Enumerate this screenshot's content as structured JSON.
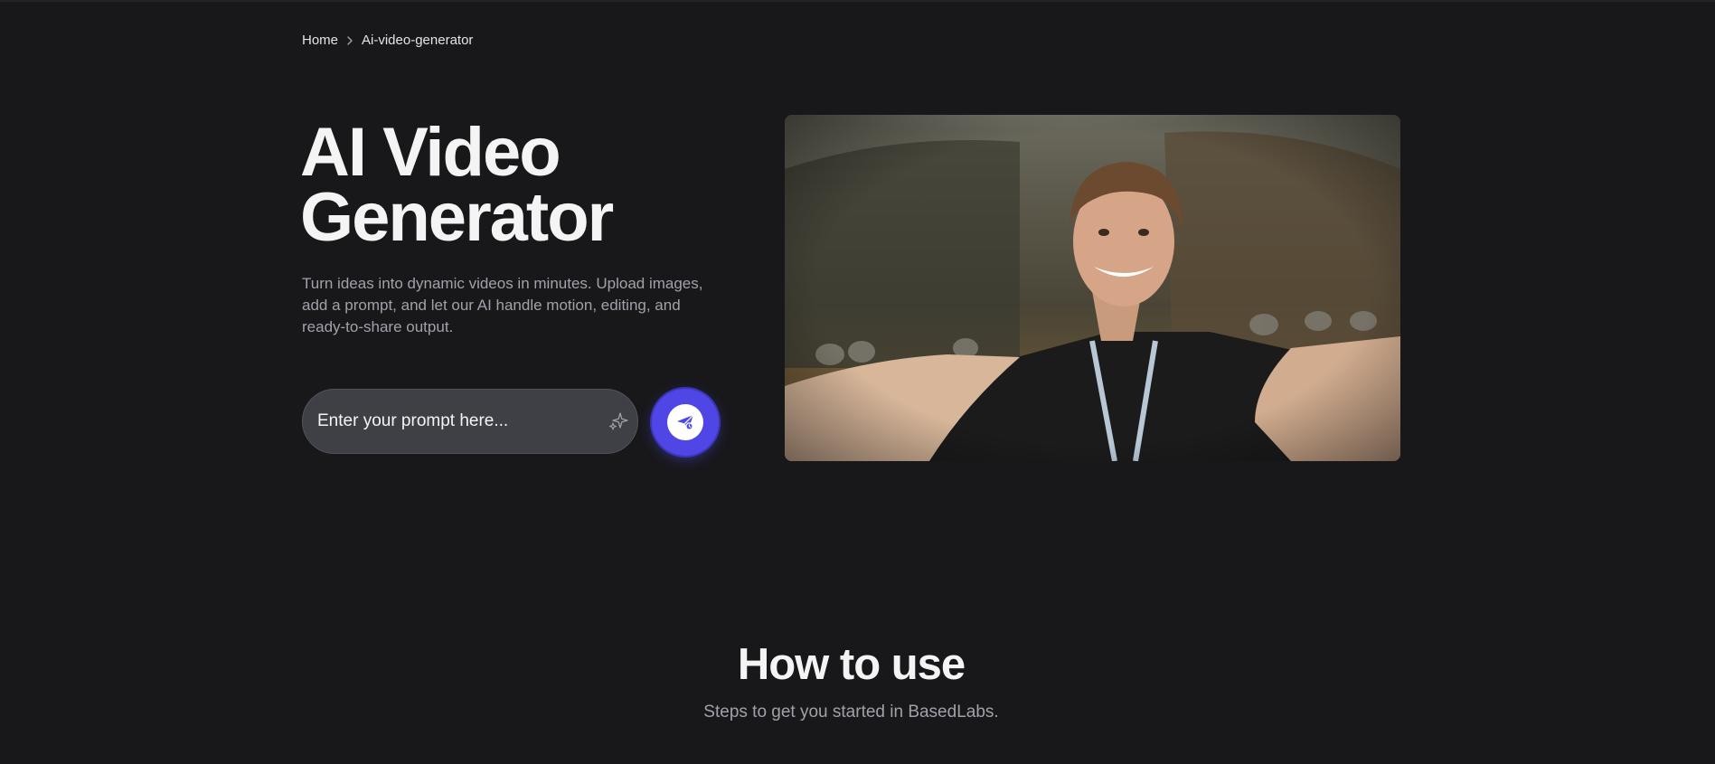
{
  "breadcrumb": {
    "home": "Home",
    "separator_icon": "chevron-right-icon",
    "current": "Ai-video-generator"
  },
  "hero": {
    "title": "AI Video Generator",
    "description": "Turn ideas into dynamic videos in minutes. Upload images, add a prompt, and let our AI handle motion, editing, and ready-to-share output.",
    "prompt_placeholder": "Enter your prompt here...",
    "prompt_value": "",
    "sparkle_icon": "sparkle-icon",
    "send_icon": "send-icon",
    "accent_color": "#4f46e5"
  },
  "how_to_use": {
    "title": "How to use",
    "subtitle": "Steps to get you started in BasedLabs."
  },
  "colors": {
    "background": "#18181b",
    "text_primary": "#f4f4f5",
    "text_secondary": "#a1a1aa",
    "input_bg": "#3f3f46"
  }
}
